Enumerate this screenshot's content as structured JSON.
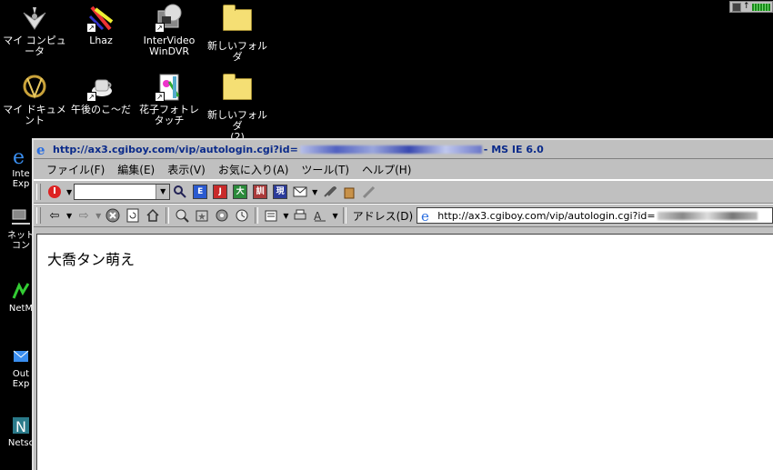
{
  "desktop": {
    "icons": [
      {
        "label": "マイ コンピュータ",
        "icon": "my-computer-icon"
      },
      {
        "label": "Lhaz",
        "icon": "lhaz-icon"
      },
      {
        "label": "InterVideo\nWinDVR",
        "icon": "windvr-icon"
      },
      {
        "label": "新しいフォルダ",
        "icon": "folder-icon"
      },
      {
        "label": "マイ ドキュメント",
        "icon": "my-documents-icon"
      },
      {
        "label": "午後のこ〜だ",
        "icon": "gogo-coda-icon"
      },
      {
        "label": "花子フォトレタッチ",
        "icon": "hanako-icon"
      },
      {
        "label": "新しいフォルダ\n(2)",
        "icon": "folder-icon"
      }
    ],
    "left_column": [
      {
        "label": "Inte\nExp",
        "icon": "internet-explorer-icon"
      },
      {
        "label": "ネット\nコン",
        "icon": "network-icon"
      },
      {
        "label": "NetM",
        "icon": "netmeeting-icon"
      },
      {
        "label": "Out\nExp",
        "icon": "outlook-express-icon"
      },
      {
        "label": "Netsc",
        "icon": "netscape-icon"
      }
    ]
  },
  "window": {
    "title_prefix": "http://ax3.cgiboy.com/vip/autologin.cgi?id=",
    "title_suffix": " - MS IE 6.0",
    "menu": [
      "ファイル(F)",
      "編集(E)",
      "表示(V)",
      "お気に入り(A)",
      "ツール(T)",
      "ヘルプ(H)"
    ],
    "address_label": "アドレス(D)",
    "address_value": "http://ax3.cgiboy.com/vip/autologin.cgi?id=",
    "page_text": "大喬タン萌え"
  },
  "colors": {
    "desktop_bg": "#000000",
    "chrome": "#c0c0c0",
    "title_text": "#0a2a8a"
  }
}
